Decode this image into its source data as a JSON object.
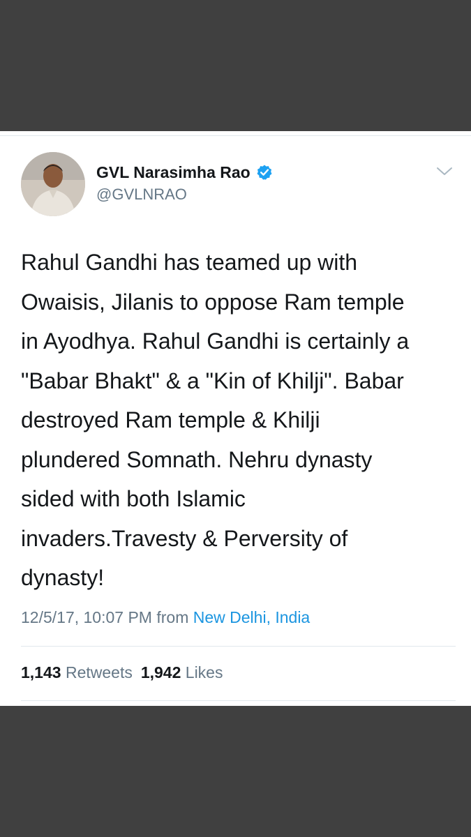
{
  "author": {
    "display_name": "GVL Narasimha Rao",
    "handle": "@GVLNRAO",
    "verified": true
  },
  "tweet": {
    "text": "Rahul Gandhi has teamed up with\nOwaisis, Jilanis to oppose Ram temple\nin Ayodhya. Rahul Gandhi is certainly a\n\"Babar Bhakt\" & a \"Kin of Khilji\". Babar\ndestroyed Ram temple & Khilji\nplundered Somnath. Nehru dynasty\nsided with both Islamic\ninvaders.Travesty & Perversity of\ndynasty!",
    "timestamp": "12/5/17, 10:07 PM",
    "from_label": "from",
    "location": "New Delhi, India"
  },
  "stats": {
    "retweets_count": "1,143",
    "retweets_label": "Retweets",
    "likes_count": "1,942",
    "likes_label": "Likes"
  },
  "icons": {
    "verified": "verified-badge-icon",
    "menu": "chevron-down-icon"
  },
  "colors": {
    "verified_blue": "#1da1f2",
    "link_blue": "#1b95e0",
    "secondary_text": "#657786",
    "primary_text": "#14171a",
    "frame": "#404040"
  }
}
